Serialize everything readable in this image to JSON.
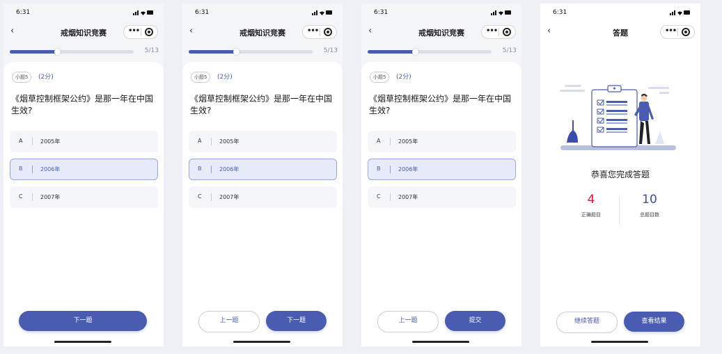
{
  "status_time": "6:31",
  "nav_back_glyph": "‹",
  "capsule_dots": "•••",
  "screens": [
    {
      "nav_title": "戒烟知识竞赛",
      "progress": {
        "current": 5,
        "total": 13,
        "label": "5/13"
      },
      "question": {
        "tag": "小题5",
        "score": "(2分)",
        "text": "《烟草控制框架公约》是那一年在中国生效?",
        "options": [
          {
            "letter": "A",
            "text": "2005年",
            "selected": false
          },
          {
            "letter": "B",
            "text": "2006年",
            "selected": true
          },
          {
            "letter": "C",
            "text": "2007年",
            "selected": false
          }
        ]
      },
      "buttons": {
        "next": "下一题"
      }
    },
    {
      "nav_title": "戒烟知识竞赛",
      "progress": {
        "current": 5,
        "total": 13,
        "label": "5/13"
      },
      "question": {
        "tag": "小题5",
        "score": "(2分)",
        "text": "《烟草控制框架公约》是那一年在中国生效?",
        "options": [
          {
            "letter": "A",
            "text": "2005年",
            "selected": false
          },
          {
            "letter": "B",
            "text": "2006年",
            "selected": true
          },
          {
            "letter": "C",
            "text": "2007年",
            "selected": false
          }
        ]
      },
      "buttons": {
        "prev": "上一题",
        "next": "下一题"
      }
    },
    {
      "nav_title": "戒烟知识竞赛",
      "progress": {
        "current": 5,
        "total": 13,
        "label": "5/13"
      },
      "question": {
        "tag": "小题5",
        "score": "(2分)",
        "text": "《烟草控制框架公约》是那一年在中国生效?",
        "options": [
          {
            "letter": "A",
            "text": "2005年",
            "selected": false
          },
          {
            "letter": "B",
            "text": "2006年",
            "selected": true
          },
          {
            "letter": "C",
            "text": "2007年",
            "selected": false
          }
        ]
      },
      "buttons": {
        "prev": "上一题",
        "submit": "提交"
      }
    },
    {
      "nav_title": "答题",
      "result": {
        "title": "恭喜您完成答题",
        "correct_count": "4",
        "correct_label": "正确题目",
        "total_count": "10",
        "total_label": "总题目数"
      },
      "buttons": {
        "continue": "继续答题",
        "view_result": "查看结果"
      }
    }
  ],
  "colors": {
    "accent": "#4a5bb2",
    "correct_red": "#e8142d",
    "total_blue": "#3c4ea8",
    "background": "#eef0f5"
  },
  "icons": [
    "signal-icon",
    "wifi-icon",
    "battery-icon",
    "back-arrow-icon",
    "more-dots-icon",
    "target-icon",
    "checklist-illustration-icon"
  ]
}
